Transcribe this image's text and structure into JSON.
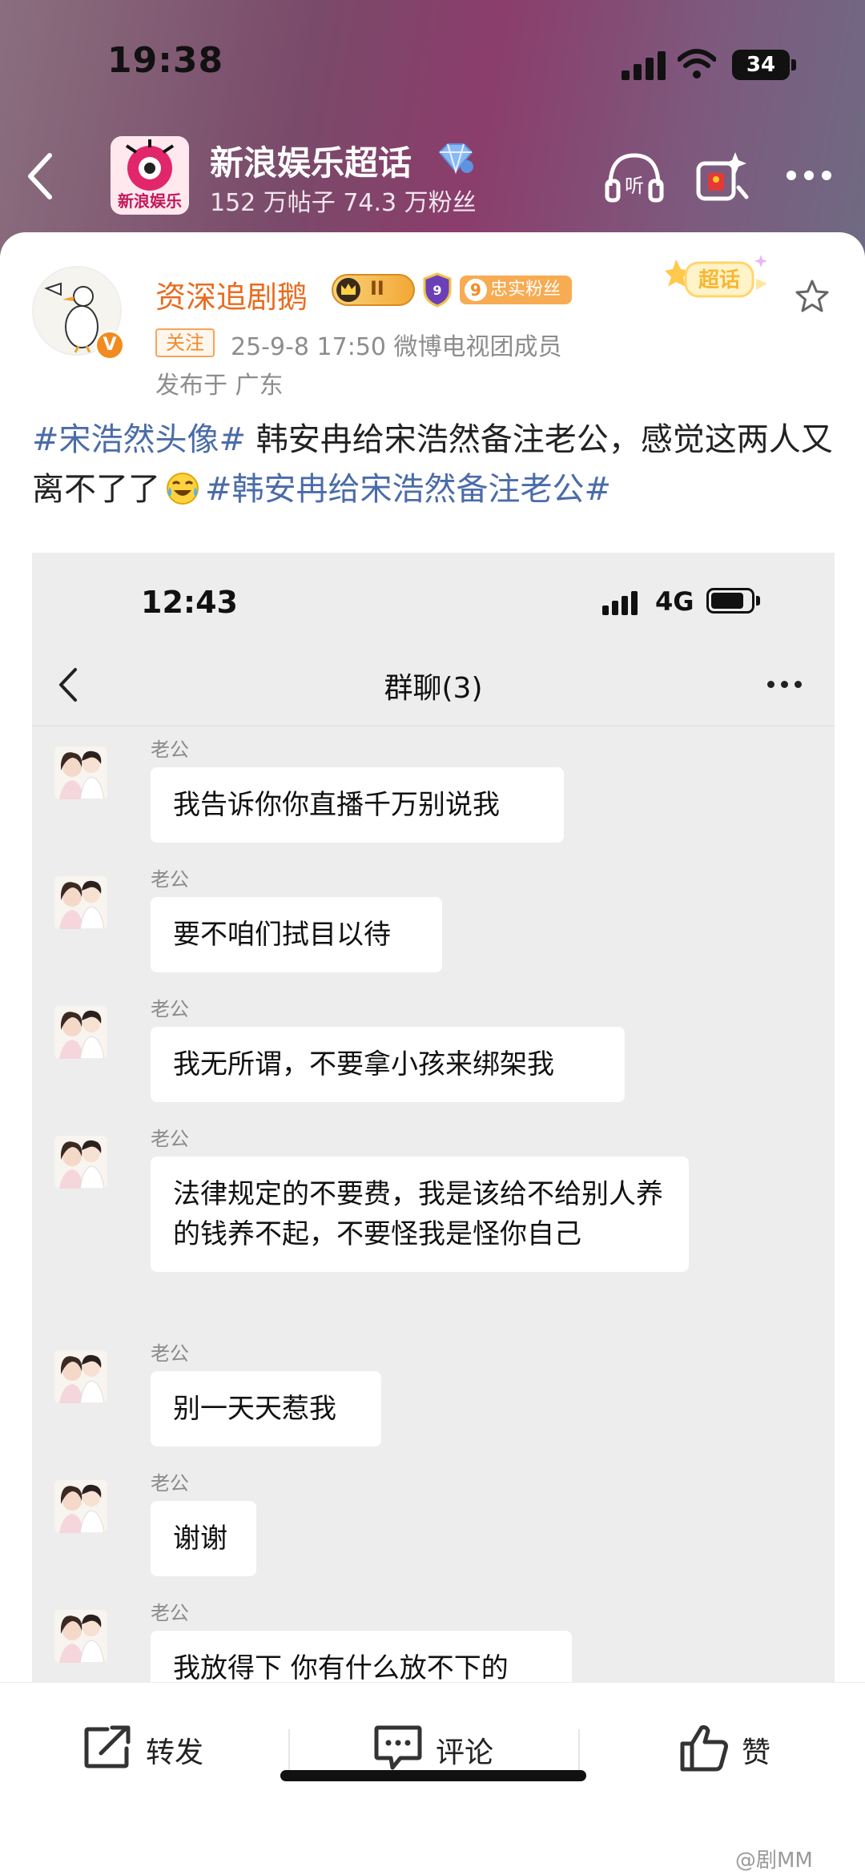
{
  "status_bar": {
    "time": "19:38",
    "battery": "34"
  },
  "topic": {
    "avatar_text": "新浪娱乐",
    "name": "新浪娱乐超话",
    "stats": "152 万帖子 74.3 万粉丝"
  },
  "post": {
    "author": "资深追剧鹅",
    "level_badge": "II",
    "fan_badge": "忠实粉丝",
    "fan_badge_num": "9",
    "follow_tag": "关注",
    "meta": "25-9-8 17:50  微博电视团成员",
    "location": "发布于 广东",
    "chaohua_badge": "超话",
    "text": {
      "tag1": "#宋浩然头像#",
      "body": " 韩安冉给宋浩然备注老公，感觉这两人又离不了了",
      "tag2": "#韩安冉给宋浩然备注老公#"
    }
  },
  "screenshot": {
    "status_time": "12:43",
    "network": "4G",
    "title": "群聊(3)",
    "messages": [
      {
        "sender": "老公",
        "text": "我告诉你你直播千万别说我"
      },
      {
        "sender": "老公",
        "text": "要不咱们拭目以待"
      },
      {
        "sender": "老公",
        "text": "我无所谓，不要拿小孩来绑架我"
      },
      {
        "sender": "老公",
        "text": "法律规定的不要费，我是该给不给别人养的钱养不起，不要怪我是怪你自己"
      },
      {
        "sender": "老公",
        "text": "别一天天惹我"
      },
      {
        "sender": "老公",
        "text": "谢谢"
      },
      {
        "sender": "老公",
        "text": "我放得下 你有什么放不下的"
      }
    ]
  },
  "actions": {
    "repost": "转发",
    "comment": "评论",
    "like": "赞"
  },
  "watermark": "@剧MM",
  "colors": {
    "accent_orange": "#e96c1f",
    "hashtag_blue": "#4b6ca8",
    "chat_bg": "#ededed"
  }
}
